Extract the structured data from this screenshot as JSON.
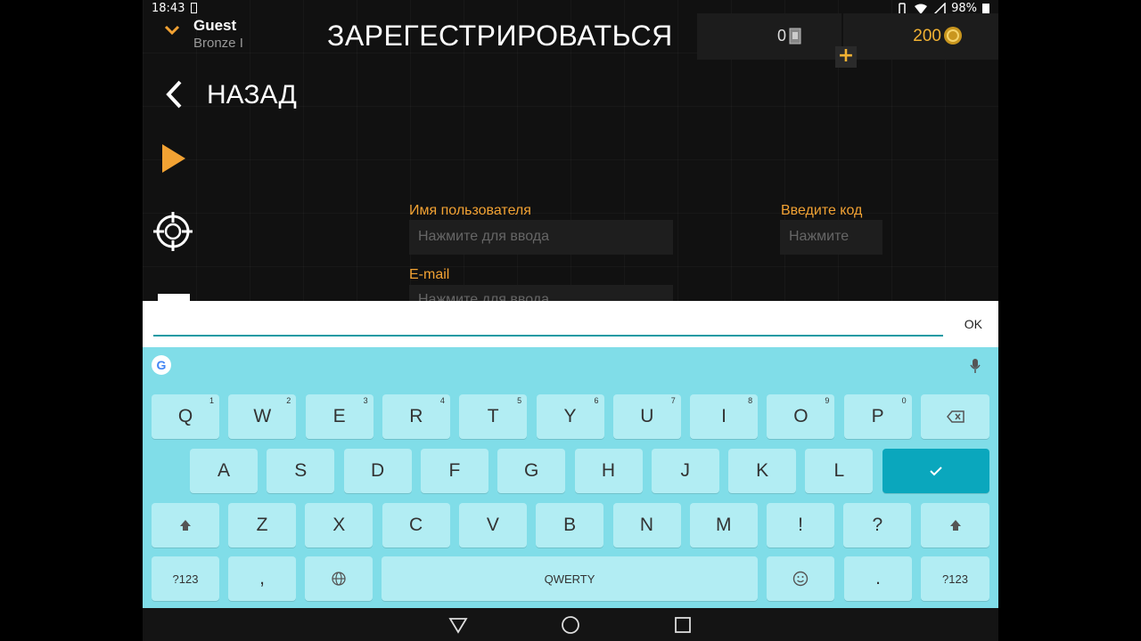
{
  "status": {
    "time": "18:43",
    "battery": "98%"
  },
  "profile": {
    "name": "Guest",
    "rank": "Bronze I"
  },
  "page_title": "ЗАРЕГЕСТРИРОВАТЬСЯ",
  "currency": {
    "cards": "0",
    "coins": "200",
    "add_label": "+"
  },
  "back_label": "НАЗАД",
  "form": {
    "username_label": "Имя пользователя",
    "username_placeholder": "Нажмите для ввода",
    "email_label": "E-mail",
    "email_placeholder": "Нажмите для ввода",
    "code_label": "Введите код",
    "code_placeholder": "Нажмите"
  },
  "input_bar": {
    "ok_label": "OK"
  },
  "keyboard": {
    "row1": [
      [
        "Q",
        "1"
      ],
      [
        "W",
        "2"
      ],
      [
        "E",
        "3"
      ],
      [
        "R",
        "4"
      ],
      [
        "T",
        "5"
      ],
      [
        "Y",
        "6"
      ],
      [
        "U",
        "7"
      ],
      [
        "I",
        "8"
      ],
      [
        "O",
        "9"
      ],
      [
        "P",
        "0"
      ]
    ],
    "row2": [
      "A",
      "S",
      "D",
      "F",
      "G",
      "H",
      "J",
      "K",
      "L"
    ],
    "row3": [
      "Z",
      "X",
      "C",
      "V",
      "B",
      "N",
      "M",
      "!",
      "?"
    ],
    "symbols_label": "?123",
    "comma_label": ",",
    "space_label": "QWERTY",
    "period_label": "."
  },
  "colors": {
    "accent": "#f2a233",
    "keyboard_bg": "#80dde8",
    "key_bg": "#b2edf3",
    "enter_bg": "#0aa7bd",
    "input_line": "#199aa3"
  }
}
